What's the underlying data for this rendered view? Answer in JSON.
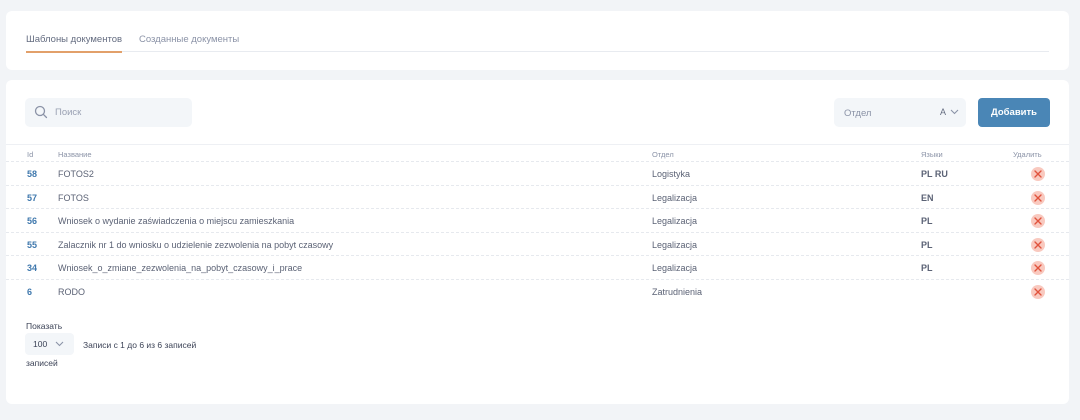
{
  "tabs": {
    "templates": "Шаблоны документов",
    "created": "Созданные документы"
  },
  "toolbar": {
    "search_placeholder": "Поиск",
    "department_label": "Отдел",
    "department_value": "A",
    "add_label": "Добавить"
  },
  "table": {
    "headers": {
      "id": "Id",
      "name": "Название",
      "department": "Отдел",
      "languages": "Языки",
      "delete": "Удалить"
    },
    "rows": [
      {
        "id": "58",
        "name": "FOTOS2",
        "department": "Logistyka",
        "languages": "PL RU"
      },
      {
        "id": "57",
        "name": "FOTOS",
        "department": "Legalizacja",
        "languages": "EN"
      },
      {
        "id": "56",
        "name": "Wniosek o wydanie zaświadczenia o miejscu zamieszkania",
        "department": "Legalizacja",
        "languages": "PL"
      },
      {
        "id": "55",
        "name": "Zalacznik nr 1 do wniosku o udzielenie zezwolenia na pobyt czasowy",
        "department": "Legalizacja",
        "languages": "PL"
      },
      {
        "id": "34",
        "name": "Wniosek_o_zmiane_zezwolenia_na_pobyt_czasowy_i_prace",
        "department": "Legalizacja",
        "languages": "PL"
      },
      {
        "id": "6",
        "name": "RODO",
        "department": "Zatrudnienia",
        "languages": ""
      }
    ]
  },
  "footer": {
    "show_label": "Показать",
    "page_size": "100",
    "records_label": "записей",
    "info": "Записи с 1 до 6 из 6 записей"
  },
  "colors": {
    "accent": "#4a86b6",
    "tab_underline": "#e2a06a",
    "delete_bg": "#f9c9bf",
    "delete_icon": "#e0533d"
  }
}
